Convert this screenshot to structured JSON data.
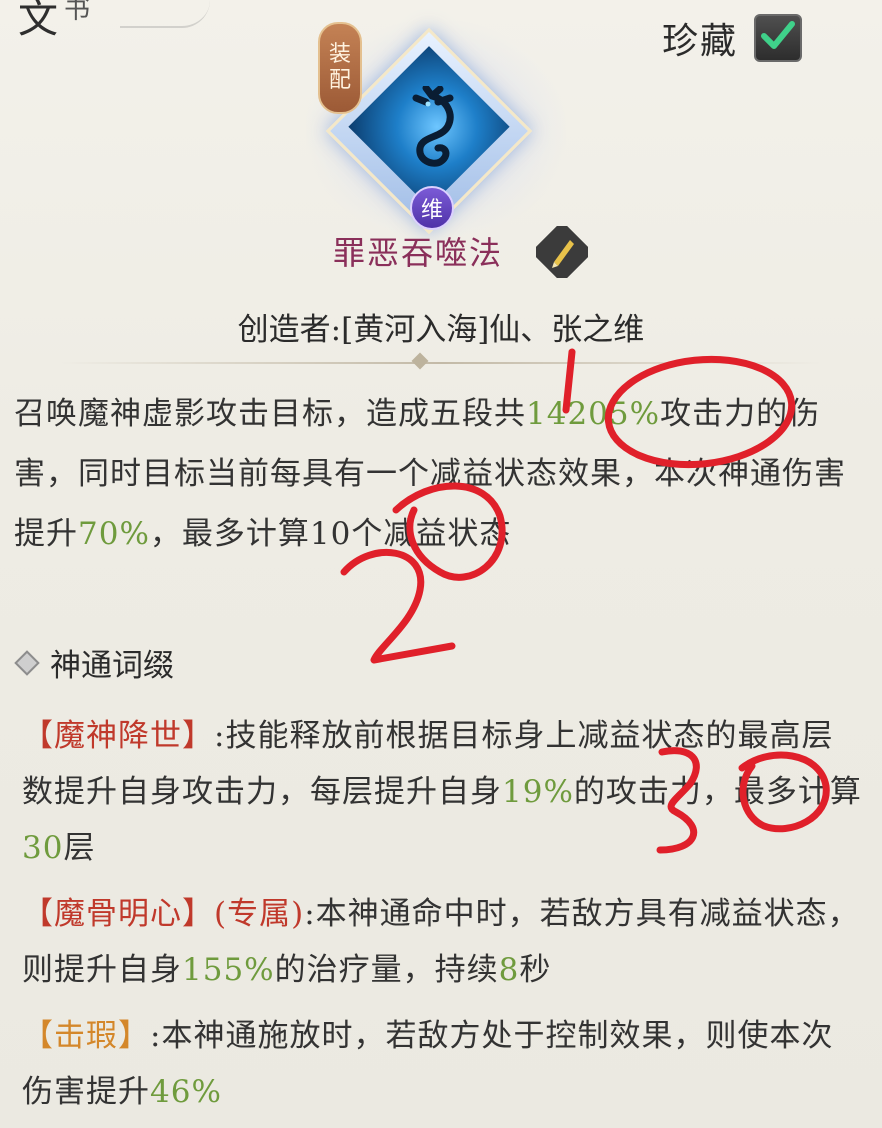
{
  "header": {
    "corner_title_main": "文",
    "corner_title_sub": "书",
    "collect_label": "珍藏",
    "collect_checked": true
  },
  "skill": {
    "equip_badge": [
      "装",
      "配"
    ],
    "grade_badge": "维",
    "name": "罪恶吞噬法",
    "icon": "dragon-icon"
  },
  "creator": "创造者:[黄河入海]仙、张之维",
  "description": {
    "parts": [
      "召唤魔神虚影攻击目标，造成五段共",
      "14205%",
      "攻击力的伤害，同时目标当前每具有一个减益状态效果，本次神通伤害提升",
      "70%",
      "，最多计算10个减益状态"
    ]
  },
  "section": {
    "title": "神通词缀"
  },
  "affixes": [
    {
      "tag": "【魔神降世】",
      "extra": "",
      "parts": [
        ":技能释放前根据目标身上减益状态的最高层数提升自身攻击力，每层提升自身",
        "19%",
        "的攻击力，最多计算",
        "30",
        "层"
      ]
    },
    {
      "tag": "【魔骨明心】",
      "extra": "(专属)",
      "parts": [
        ":本神通命中时，若敌方具有减益状态，则提升自身",
        "155%",
        "的治疗量，持续",
        "8",
        "秒"
      ]
    },
    {
      "tag": "【击瑕】",
      "extra": "",
      "parts": [
        ":本神通施放时，若敌方处于控制效果，则使本次伤害提升",
        "46%",
        ""
      ]
    }
  ],
  "annotations": {
    "marks": [
      "1",
      "2",
      "3"
    ],
    "color": "#e0202a"
  },
  "colors": {
    "value_green": "#6f9b3d",
    "tag_red": "#c0392b",
    "tag_orange": "#d4872a",
    "skill_name": "#8a2f5a"
  }
}
